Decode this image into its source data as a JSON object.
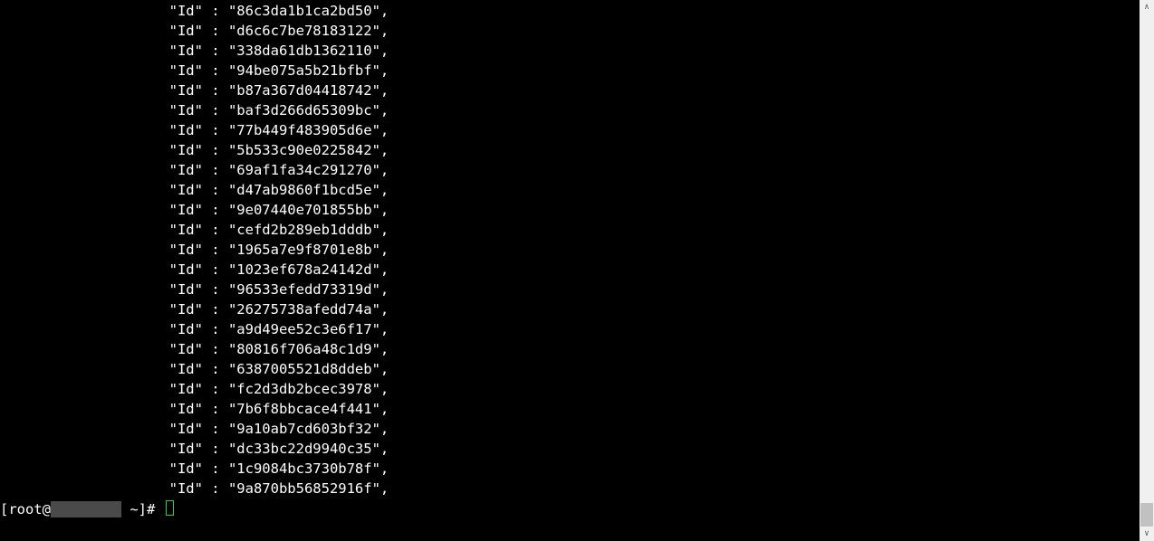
{
  "terminal": {
    "indent": "                    ",
    "key": "\"Id\"",
    "sep": " : ",
    "entries": [
      "86c3da1b1ca2bd50",
      "d6c6c7be78183122",
      "338da61db1362110",
      "94be075a5b21bfbf",
      "b87a367d04418742",
      "baf3d266d65309bc",
      "77b449f483905d6e",
      "5b533c90e0225842",
      "69af1fa34c291270",
      "d47ab9860f1bcd5e",
      "9e07440e701855bb",
      "cefd2b289eb1dddb",
      "1965a7e9f8701e8b",
      "1023ef678a24142d",
      "96533efedd73319d",
      "26275738afedd74a",
      "a9d49ee52c3e6f17",
      "80816f706a48c1d9",
      "6387005521d8ddeb",
      "fc2d3db2bcec3978",
      "7b6f8bbcace4f441",
      "9a10ab7cd603bf32",
      "dc33bc22d9940c35",
      "1c9084bc3730b78f",
      "9a870bb56852916f"
    ],
    "prompt_prefix": "[root@",
    "prompt_suffix": " ~]# "
  }
}
